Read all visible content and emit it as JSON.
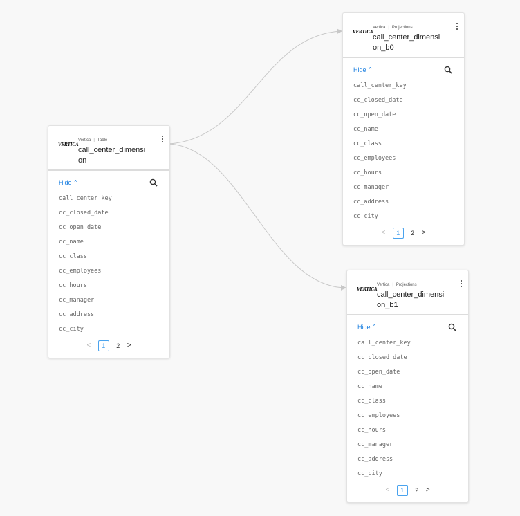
{
  "cards": {
    "table": {
      "logo": "VERTICA",
      "source": "Vertica",
      "kind": "Table",
      "name": "call_center_dimension",
      "hide_label": "Hide",
      "columns": [
        "call_center_key",
        "cc_closed_date",
        "cc_open_date",
        "cc_name",
        "cc_class",
        "cc_employees",
        "cc_hours",
        "cc_manager",
        "cc_address",
        "cc_city"
      ],
      "pages": [
        "1",
        "2"
      ],
      "current_page": "1"
    },
    "proj_b0": {
      "logo": "VERTICA",
      "source": "Vertica",
      "kind": "Projections",
      "name": "call_center_dimension_b0",
      "hide_label": "Hide",
      "columns": [
        "call_center_key",
        "cc_closed_date",
        "cc_open_date",
        "cc_name",
        "cc_class",
        "cc_employees",
        "cc_hours",
        "cc_manager",
        "cc_address",
        "cc_city"
      ],
      "pages": [
        "1",
        "2"
      ],
      "current_page": "1"
    },
    "proj_b1": {
      "logo": "VERTICA",
      "source": "Vertica",
      "kind": "Projections",
      "name": "call_center_dimension_b1",
      "hide_label": "Hide",
      "columns": [
        "call_center_key",
        "cc_closed_date",
        "cc_open_date",
        "cc_name",
        "cc_class",
        "cc_employees",
        "cc_hours",
        "cc_manager",
        "cc_address",
        "cc_city"
      ],
      "pages": [
        "1",
        "2"
      ],
      "current_page": "1"
    }
  },
  "icons": {
    "menu": "more-vertical-icon",
    "search": "search-icon",
    "hide": "chevron-up-icon",
    "prev": "chevron-left-icon",
    "next": "chevron-right-icon"
  },
  "colors": {
    "accent": "#1b7fe0",
    "edge": "#c8c8c8"
  }
}
